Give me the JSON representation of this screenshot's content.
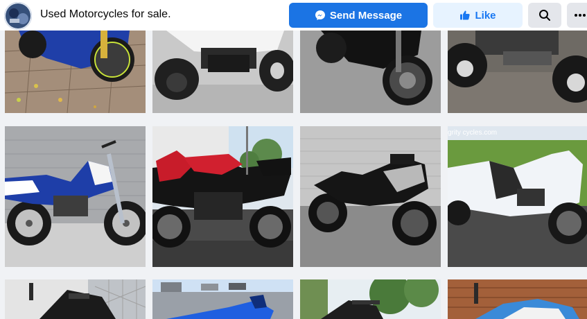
{
  "header": {
    "page_name": "Used Motorcycles for sale.",
    "send_label": "Send Message",
    "like_label": "Like",
    "colors": {
      "primary": "#1b74e4",
      "like_bg": "#e7f3ff",
      "like_text": "#1877f2",
      "neutral_btn": "#e4e6eb"
    }
  },
  "grid": {
    "watermark": "grity cycles.com",
    "tiles": [
      {
        "subject": "blue sport bike on brick pavement"
      },
      {
        "subject": "white youth ATV"
      },
      {
        "subject": "black sport bike"
      },
      {
        "subject": "ATV wheels"
      },
      {
        "subject": "blue and white dirt bike"
      },
      {
        "subject": "red and black sport bike"
      },
      {
        "subject": "black and silver sport bike"
      },
      {
        "subject": "white sport bike on grass"
      },
      {
        "subject": "black sport bike near fence"
      },
      {
        "subject": "blue bike in parking lot"
      },
      {
        "subject": "bike under trees"
      },
      {
        "subject": "blue and white bike by wooden wall"
      }
    ]
  }
}
